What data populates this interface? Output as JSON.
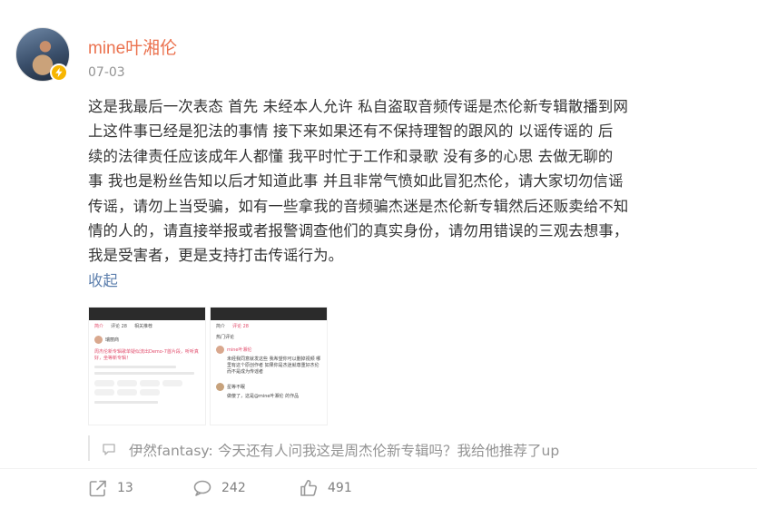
{
  "author": {
    "name": "mine叶湘伦",
    "verified_badge": "v-badge-icon",
    "post_date": "07-03"
  },
  "post": {
    "text": "这是我最后一次表态 首先 未经本人允许 私自盗取音频传谣是杰伦新专辑散播到网\n上这件事已经是犯法的事情  接下来如果还有不保持理智的跟风的 以谣传谣的 后\n续的法律责任应该成年人都懂   我平时忙于工作和录歌 没有多的心思 去做无聊的\n事 我也是粉丝告知以后才知道此事 并且非常气愤如此冒犯杰伦，请大家切勿信谣\n传谣，请勿上当受骗，如有一些拿我的音频骗杰迷是杰伦新专辑然后还贩卖给不知\n情的人的，请直接举报或者报警调查他们的真实身份，请勿用错误的三观去想事，\n我是受害者，更是支持打击传谣行为。",
    "collapse_label": "收起"
  },
  "thumbnails": [
    {
      "tabs": [
        "简介",
        "评论 28",
        "相关推荐"
      ],
      "title": "周杰伦新专辑歌单疑似流出Demo-7首片段，听听真好，坐等新专辑！",
      "user": "瑞丽商"
    },
    {
      "tabs": [
        "简介",
        "评论 28"
      ],
      "section": "热门评论",
      "comment_user": "mine叶湘伦",
      "comment_text": "未经我同意就发这些 我希望你可以删掉视频 哪里有这个原创作者 如果你是杰迷就尊重好杰伦 而不是成为传谣者",
      "reply_user": "星等不眠",
      "reply_text": "做傻了，这是@mine叶湘伦 的作品"
    }
  ],
  "forwarded_comment": {
    "author": "伊然fantasy:",
    "text": "今天还有人问我这是周杰伦新专辑吗？我给他推荐了up"
  },
  "actions": {
    "repost_count": "13",
    "comment_count": "242",
    "like_count": "491"
  },
  "colors": {
    "username": "#eb7350",
    "link": "#5d7fad",
    "badge": "#f7b500",
    "muted": "#939393"
  }
}
